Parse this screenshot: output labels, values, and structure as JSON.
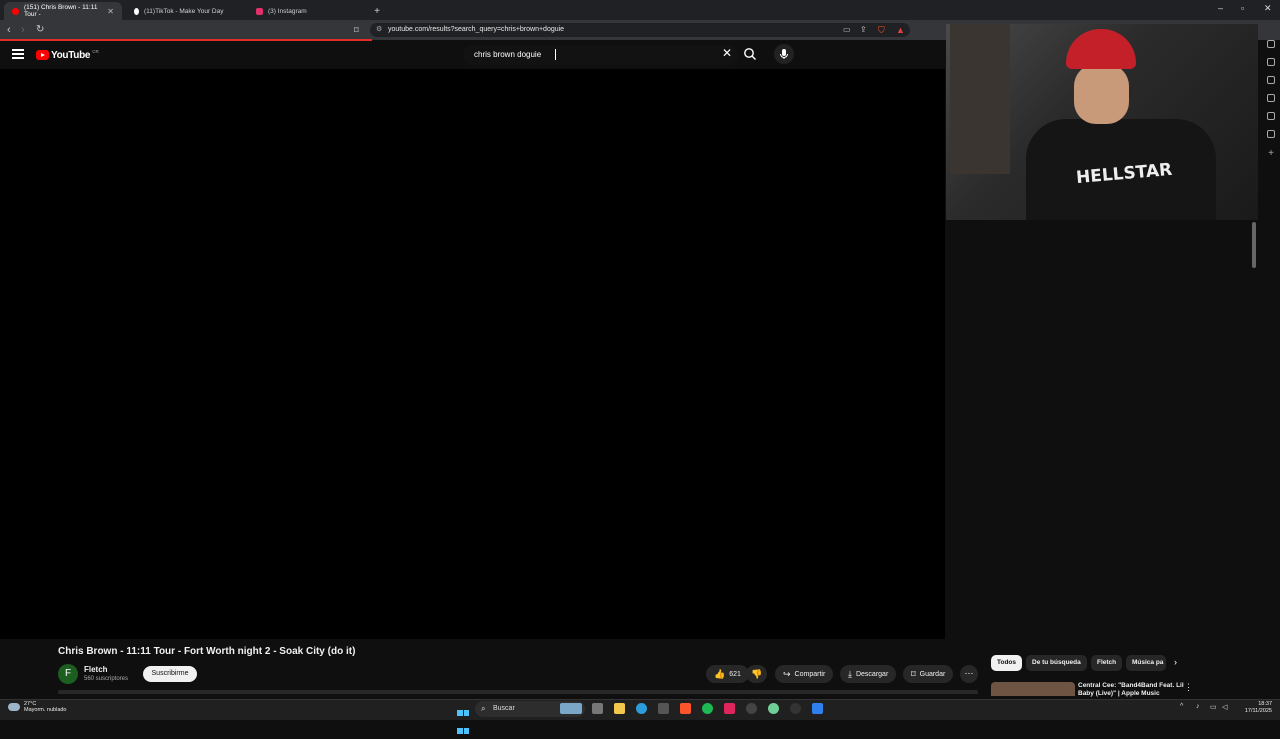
{
  "browser": {
    "tabs": [
      {
        "label": "(151) Chris Brown - 11:11 Tour -",
        "active": true,
        "favicon_color": "#ff0000"
      },
      {
        "label": "(11)TikTok - Make Your Day",
        "active": false,
        "favicon_color": "#ffffff"
      },
      {
        "label": "(3) Instagram",
        "active": false,
        "favicon_color": "#e1306c"
      }
    ],
    "new_tab": "+",
    "url": "youtube.com/results?search_query=chris+brown+doguie"
  },
  "youtube": {
    "logo_text": "YouTube",
    "country_code": "CR",
    "search_value": "chris brown doguie",
    "accent": "#ff0000"
  },
  "webcam": {
    "shirt_text": "HELLSTAR"
  },
  "video": {
    "title": "Chris Brown - 11:11 Tour - Fort Worth night 2 - Soak City (do it)",
    "channel_initial": "F",
    "channel_name": "Fletch",
    "subscribers": "560 suscriptores",
    "subscribe_label": "Suscribirme",
    "likes": "621",
    "share_label": "Compartir",
    "download_label": "Descargar",
    "save_label": "Guardar"
  },
  "chips": [
    "Todos",
    "De tu búsqueda",
    "Fletch",
    "Música pa"
  ],
  "recommendation": {
    "title": "Central Cee: \"Band4Band Feat. Lil Baby (Live)\" | Apple Music"
  },
  "taskbar": {
    "weather_temp": "27°C",
    "weather_desc": "Mayorm. nublado",
    "search_label": "Buscar",
    "time": "18:37",
    "date": "17/11/2025"
  }
}
